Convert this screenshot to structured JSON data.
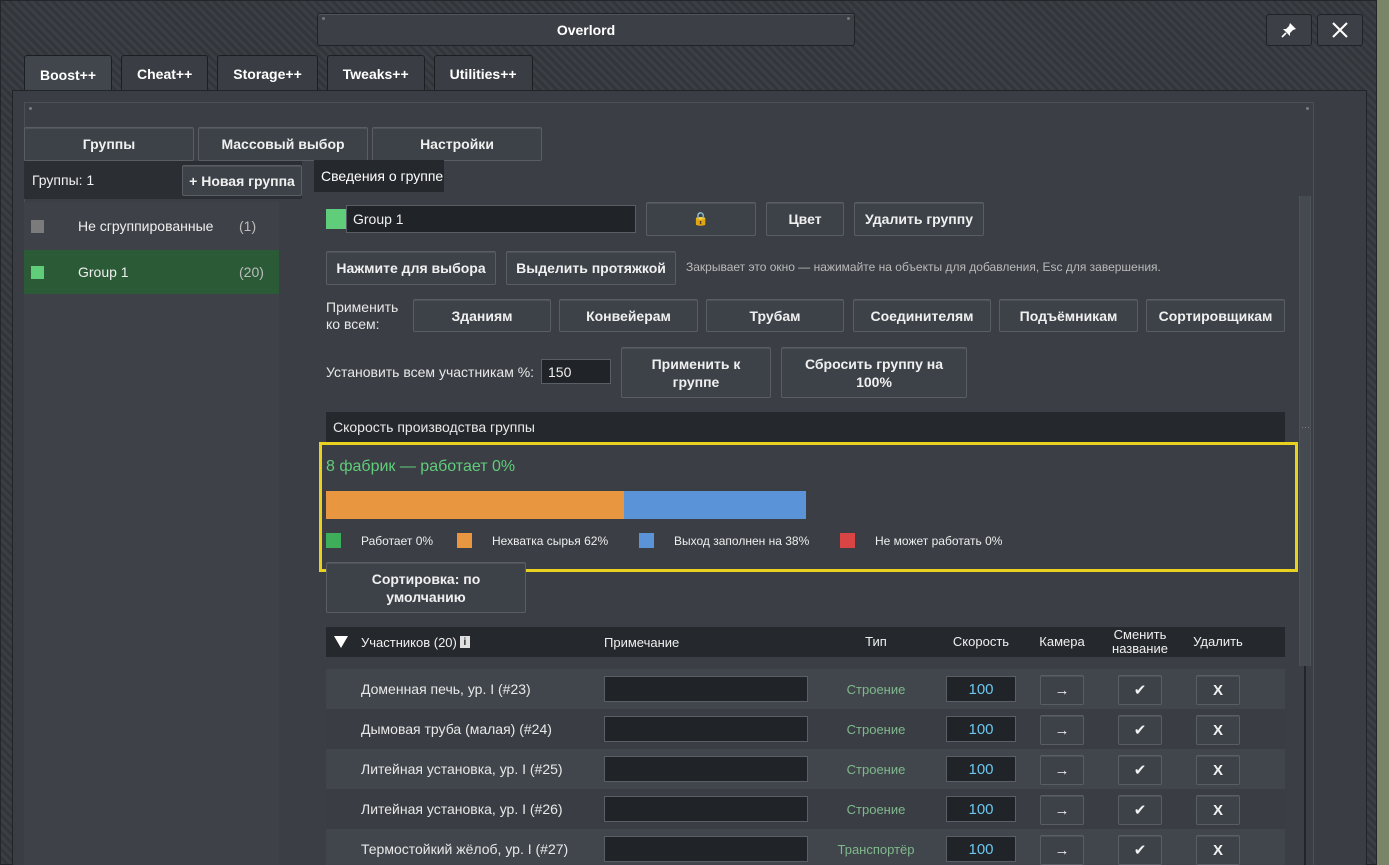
{
  "window": {
    "title": "Overlord",
    "pin_icon": "pin-icon",
    "close_icon": "close-icon"
  },
  "main_tabs": [
    {
      "label": "Boost++",
      "active": true
    },
    {
      "label": "Cheat++",
      "active": false
    },
    {
      "label": "Storage++",
      "active": false
    },
    {
      "label": "Tweaks++",
      "active": false
    },
    {
      "label": "Utilities++",
      "active": false
    }
  ],
  "sub_tabs": [
    "Группы",
    "Массовый выбор",
    "Настройки"
  ],
  "groups_panel": {
    "count_label": "Группы: 1",
    "new_group_label": "+ Новая группа",
    "items": [
      {
        "name": "Не сгруппированные",
        "count": "(1)",
        "color": "#7b7b7b",
        "selected": false
      },
      {
        "name": "Group 1",
        "count": "(20)",
        "color": "#5fcd7a",
        "selected": true
      }
    ]
  },
  "details": {
    "tab_label": "Сведения о группе",
    "group_name_value": "Group 1",
    "group_color": "#5fcd7a",
    "lock_label": "🔒",
    "color_button": "Цвет",
    "delete_button": "Удалить группу",
    "select_button": "Нажмите для выбора",
    "drag_select_button": "Выделить протяжкой",
    "hint": "Закрывает это окно — нажимайте на объекты для добавления, Esc для завершения.",
    "apply_label_1": "Применить",
    "apply_label_2": "ко всем:",
    "apply_buttons": [
      "Зданиям",
      "Конвейерам",
      "Трубам",
      "Соединителям",
      "Подъёмникам",
      "Сортировщикам"
    ],
    "set_pct_label": "Установить всем участникам %:",
    "set_pct_value": "150",
    "apply_group_button": "Применить к группе",
    "reset_group_button": "Сбросить группу на 100%"
  },
  "production": {
    "header": "Скорость производства группы",
    "summary": "8 фабрик — работает 0%",
    "segments": [
      {
        "name": "working",
        "fraction": 0.0,
        "color": "#3fae5a"
      },
      {
        "name": "shortage",
        "fraction": 0.62,
        "color": "#e8963f"
      },
      {
        "name": "output_full",
        "fraction": 0.38,
        "color": "#5b93d8"
      },
      {
        "name": "cannot_work",
        "fraction": 0.0,
        "color": "#d94545"
      }
    ],
    "legend": [
      {
        "label": "Работает 0%",
        "color": "#3fae5a"
      },
      {
        "label": "Нехватка сырья 62%",
        "color": "#e8963f"
      },
      {
        "label": "Выход заполнен на 38%",
        "color": "#5b93d8"
      },
      {
        "label": "Не может работать 0%",
        "color": "#d94545"
      }
    ]
  },
  "sort_button": "Сортировка: по умолчанию",
  "table": {
    "col_members": "Участников (20)",
    "info_icon": "info-icon",
    "col_note": "Примечание",
    "col_type": "Тип",
    "col_speed": "Скорость",
    "col_camera": "Камера",
    "col_rename": "Сменить название",
    "col_delete": "Удалить",
    "camera_glyph": "→",
    "rename_glyph": "✔",
    "delete_glyph": "X",
    "rows": [
      {
        "name": "Доменная печь, ур. I (#23)",
        "note": "",
        "type": "Строение",
        "speed": "100"
      },
      {
        "name": "Дымовая труба (малая) (#24)",
        "note": "",
        "type": "Строение",
        "speed": "100"
      },
      {
        "name": "Литейная установка, ур. I (#25)",
        "note": "",
        "type": "Строение",
        "speed": "100"
      },
      {
        "name": "Литейная установка, ур. I (#26)",
        "note": "",
        "type": "Строение",
        "speed": "100"
      },
      {
        "name": "Термостойкий жёлоб, ур. I (#27)",
        "note": "",
        "type": "Транспортёр",
        "speed": "100"
      }
    ]
  }
}
